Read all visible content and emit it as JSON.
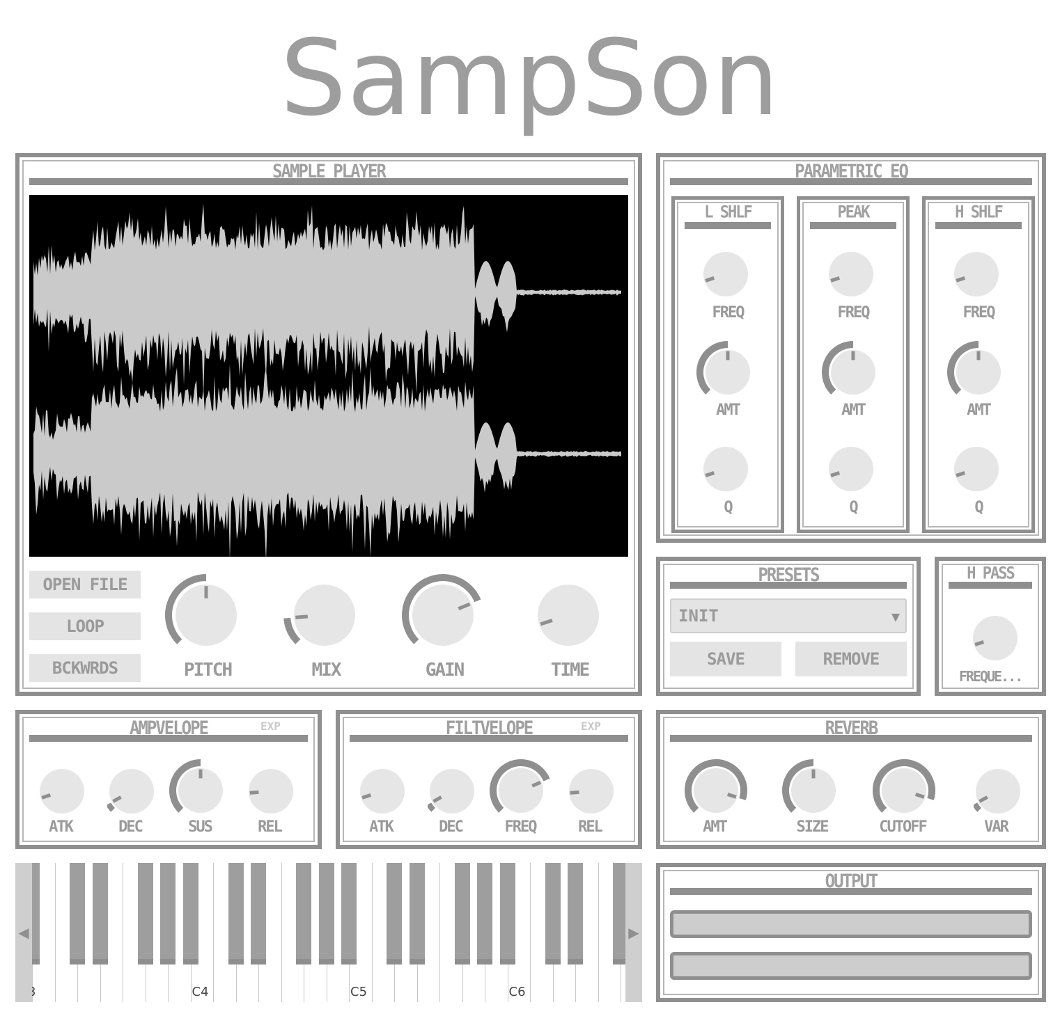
{
  "app": {
    "title": "SampSon"
  },
  "sample_player": {
    "title": "SAMPLE PLAYER",
    "buttons": {
      "open_file": "OPEN FILE",
      "loop": "LOOP",
      "backwards": "BCKWRDS"
    },
    "knobs": [
      {
        "label": "PITCH",
        "value": 0.5,
        "arc": true
      },
      {
        "label": "MIX",
        "value": 0.15,
        "arc": true
      },
      {
        "label": "GAIN",
        "value": 0.75,
        "arc": true
      },
      {
        "label": "TIME",
        "value": 0.1,
        "arc": false
      }
    ]
  },
  "eq": {
    "title": "PARAMETRIC EQ",
    "bands": [
      {
        "title": "L SHLF",
        "labels": {
          "freq": "FREQ",
          "amt": "AMT",
          "q": "Q"
        }
      },
      {
        "title": "PEAK",
        "labels": {
          "freq": "FREQ",
          "amt": "AMT",
          "q": "Q"
        }
      },
      {
        "title": "H SHLF",
        "labels": {
          "freq": "FREQ",
          "amt": "AMT",
          "q": "Q"
        }
      }
    ]
  },
  "presets": {
    "title": "PRESETS",
    "selected": "INIT",
    "save": "SAVE",
    "remove": "REMOVE"
  },
  "hpass": {
    "title": "H PASS",
    "label": "FREQUE..."
  },
  "amp_envelope": {
    "title": "AMPVELOPE",
    "exp": "EXP",
    "labels": {
      "atk": "ATK",
      "dec": "DEC",
      "sus": "SUS",
      "rel": "REL"
    }
  },
  "filt_envelope": {
    "title": "FILTVELOPE",
    "exp": "EXP",
    "labels": {
      "atk": "ATK",
      "dec": "DEC",
      "freq": "FREQ",
      "rel": "REL"
    }
  },
  "reverb": {
    "title": "REVERB",
    "labels": {
      "amt": "AMT",
      "size": "SIZE",
      "cutoff": "CUTOFF",
      "var": "VAR"
    }
  },
  "keyboard": {
    "octave_labels": [
      "3",
      "C4",
      "C5",
      "C6"
    ],
    "left_arrow": "◀",
    "right_arrow": "▶"
  },
  "output": {
    "title": "OUTPUT"
  },
  "colors": {
    "panel_border": "#8f8f8f",
    "knob_face": "#e6e6e6",
    "text": "#9a9a9a"
  }
}
